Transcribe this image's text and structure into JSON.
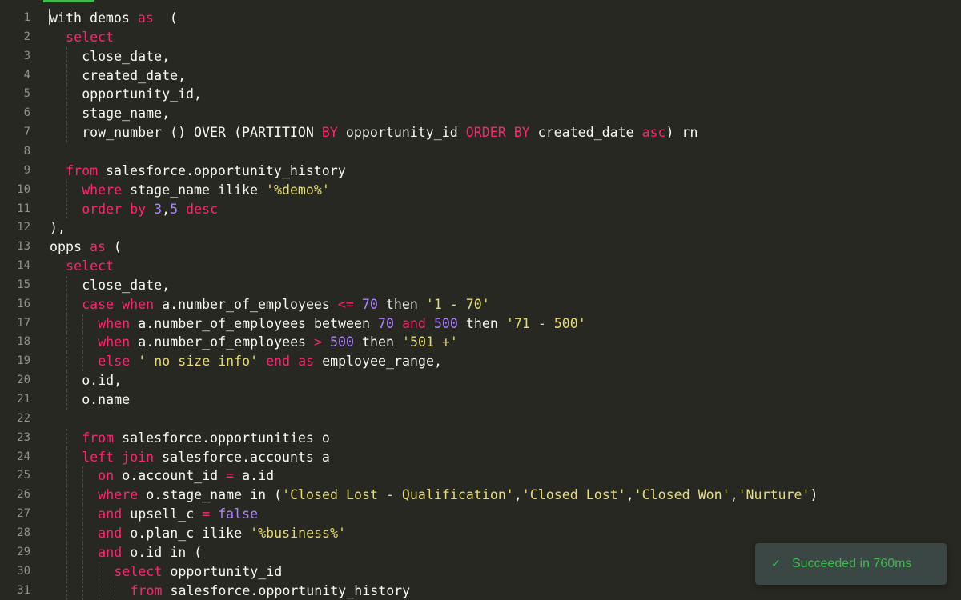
{
  "editor": {
    "accent_color": "#3fb950",
    "colors": {
      "background": "#272822",
      "keyword": "#f92672",
      "number": "#ae81ff",
      "string": "#e6db74",
      "text": "#f8f8f2",
      "line_number": "#90918b"
    },
    "lines": [
      {
        "n": "1",
        "indent": 0,
        "tokens": [
          [
            "p",
            "with demos "
          ],
          [
            "k",
            "as"
          ],
          [
            "p",
            "  ("
          ]
        ]
      },
      {
        "n": "2",
        "indent": 1,
        "tokens": [
          [
            "k",
            "select"
          ]
        ]
      },
      {
        "n": "3",
        "indent": 2,
        "tokens": [
          [
            "p",
            "close_date,"
          ]
        ]
      },
      {
        "n": "4",
        "indent": 2,
        "tokens": [
          [
            "p",
            "created_date,"
          ]
        ]
      },
      {
        "n": "5",
        "indent": 2,
        "tokens": [
          [
            "p",
            "opportunity_id,"
          ]
        ]
      },
      {
        "n": "6",
        "indent": 2,
        "tokens": [
          [
            "p",
            "stage_name,"
          ]
        ]
      },
      {
        "n": "7",
        "indent": 2,
        "tokens": [
          [
            "p",
            "row_number () OVER (PARTITION "
          ],
          [
            "k",
            "BY"
          ],
          [
            "p",
            " opportunity_id "
          ],
          [
            "k",
            "ORDER BY"
          ],
          [
            "p",
            " created_date "
          ],
          [
            "k",
            "asc"
          ],
          [
            "p",
            ") rn"
          ]
        ]
      },
      {
        "n": "8",
        "indent": 0,
        "tokens": []
      },
      {
        "n": "9",
        "indent": 1,
        "tokens": [
          [
            "k",
            "from"
          ],
          [
            "p",
            " salesforce.opportunity_history"
          ]
        ]
      },
      {
        "n": "10",
        "indent": 2,
        "tokens": [
          [
            "k",
            "where"
          ],
          [
            "p",
            " stage_name ilike "
          ],
          [
            "s",
            "'%demo%'"
          ]
        ]
      },
      {
        "n": "11",
        "indent": 2,
        "tokens": [
          [
            "k",
            "order by"
          ],
          [
            "p",
            " "
          ],
          [
            "n",
            "3"
          ],
          [
            "p",
            ","
          ],
          [
            "n",
            "5"
          ],
          [
            "p",
            " "
          ],
          [
            "k",
            "desc"
          ]
        ]
      },
      {
        "n": "12",
        "indent": 0,
        "tokens": [
          [
            "p",
            "),"
          ]
        ]
      },
      {
        "n": "13",
        "indent": 0,
        "tokens": [
          [
            "p",
            "opps "
          ],
          [
            "k",
            "as"
          ],
          [
            "p",
            " ("
          ]
        ]
      },
      {
        "n": "14",
        "indent": 1,
        "tokens": [
          [
            "k",
            "select"
          ]
        ]
      },
      {
        "n": "15",
        "indent": 2,
        "tokens": [
          [
            "p",
            "close_date,"
          ]
        ]
      },
      {
        "n": "16",
        "indent": 2,
        "tokens": [
          [
            "k",
            "case"
          ],
          [
            "p",
            " "
          ],
          [
            "k",
            "when"
          ],
          [
            "p",
            " a.number_of_employees "
          ],
          [
            "k",
            "<="
          ],
          [
            "p",
            " "
          ],
          [
            "n",
            "70"
          ],
          [
            "p",
            " then "
          ],
          [
            "s",
            "'1 - 70'"
          ]
        ]
      },
      {
        "n": "17",
        "indent": 3,
        "tokens": [
          [
            "k",
            "when"
          ],
          [
            "p",
            " a.number_of_employees between "
          ],
          [
            "n",
            "70"
          ],
          [
            "p",
            " "
          ],
          [
            "k",
            "and"
          ],
          [
            "p",
            " "
          ],
          [
            "n",
            "500"
          ],
          [
            "p",
            " then "
          ],
          [
            "s",
            "'71 - 500'"
          ]
        ]
      },
      {
        "n": "18",
        "indent": 3,
        "tokens": [
          [
            "k",
            "when"
          ],
          [
            "p",
            " a.number_of_employees "
          ],
          [
            "k",
            ">"
          ],
          [
            "p",
            " "
          ],
          [
            "n",
            "500"
          ],
          [
            "p",
            " then "
          ],
          [
            "s",
            "'501 +'"
          ]
        ]
      },
      {
        "n": "19",
        "indent": 3,
        "tokens": [
          [
            "k",
            "else"
          ],
          [
            "p",
            " "
          ],
          [
            "s",
            "' no size info'"
          ],
          [
            "p",
            " "
          ],
          [
            "k",
            "end"
          ],
          [
            "p",
            " "
          ],
          [
            "k",
            "as"
          ],
          [
            "p",
            " employee_range,"
          ]
        ]
      },
      {
        "n": "20",
        "indent": 2,
        "tokens": [
          [
            "p",
            "o.id,"
          ]
        ]
      },
      {
        "n": "21",
        "indent": 2,
        "tokens": [
          [
            "p",
            "o.name"
          ]
        ]
      },
      {
        "n": "22",
        "indent": 0,
        "tokens": []
      },
      {
        "n": "23",
        "indent": 2,
        "tokens": [
          [
            "k",
            "from"
          ],
          [
            "p",
            " salesforce.opportunities o"
          ]
        ]
      },
      {
        "n": "24",
        "indent": 2,
        "tokens": [
          [
            "k",
            "left join"
          ],
          [
            "p",
            " salesforce.accounts a"
          ]
        ]
      },
      {
        "n": "25",
        "indent": 3,
        "tokens": [
          [
            "k",
            "on"
          ],
          [
            "p",
            " o.account_id "
          ],
          [
            "k",
            "="
          ],
          [
            "p",
            " a.id"
          ]
        ]
      },
      {
        "n": "26",
        "indent": 3,
        "tokens": [
          [
            "k",
            "where"
          ],
          [
            "p",
            " o.stage_name in ("
          ],
          [
            "s",
            "'Closed Lost - Qualification'"
          ],
          [
            "p",
            ","
          ],
          [
            "s",
            "'Closed Lost'"
          ],
          [
            "p",
            ","
          ],
          [
            "s",
            "'Closed Won'"
          ],
          [
            "p",
            ","
          ],
          [
            "s",
            "'Nurture'"
          ],
          [
            "p",
            ")"
          ]
        ]
      },
      {
        "n": "27",
        "indent": 3,
        "tokens": [
          [
            "k",
            "and"
          ],
          [
            "p",
            " upsell_c "
          ],
          [
            "k",
            "="
          ],
          [
            "p",
            " "
          ],
          [
            "n",
            "false"
          ]
        ]
      },
      {
        "n": "28",
        "indent": 3,
        "tokens": [
          [
            "k",
            "and"
          ],
          [
            "p",
            " o.plan_c ilike "
          ],
          [
            "s",
            "'%business%'"
          ]
        ]
      },
      {
        "n": "29",
        "indent": 3,
        "tokens": [
          [
            "k",
            "and"
          ],
          [
            "p",
            " o.id in ("
          ]
        ]
      },
      {
        "n": "30",
        "indent": 4,
        "tokens": [
          [
            "k",
            "select"
          ],
          [
            "p",
            " opportunity_id"
          ]
        ]
      },
      {
        "n": "31",
        "indent": 5,
        "tokens": [
          [
            "k",
            "from"
          ],
          [
            "p",
            " salesforce.opportunity_history"
          ]
        ]
      }
    ]
  },
  "toast": {
    "icon": "checkmark-icon",
    "icon_glyph": "✓",
    "message": "Succeeded in 760ms"
  }
}
